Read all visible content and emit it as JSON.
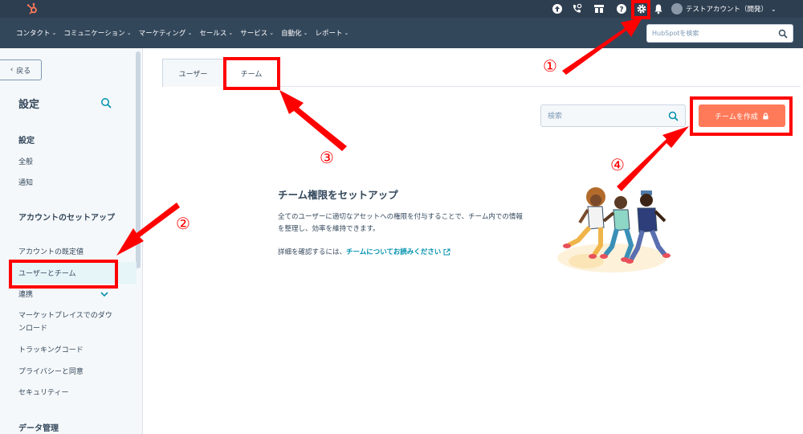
{
  "topbar": {
    "account_name": "テストアカウント（開発）",
    "icons": [
      "upgrade-icon",
      "calling-icon",
      "marketplace-icon",
      "help-icon",
      "settings-icon",
      "notifications-icon"
    ]
  },
  "nav": {
    "items": [
      {
        "label": "コンタクト"
      },
      {
        "label": "コミュニケーション"
      },
      {
        "label": "マーケティング"
      },
      {
        "label": "セールス"
      },
      {
        "label": "サービス"
      },
      {
        "label": "自動化"
      },
      {
        "label": "レポート"
      }
    ],
    "search_placeholder": "HubSpotを検索"
  },
  "sidebar": {
    "back_label": "戻る",
    "title": "設定",
    "sections": [
      {
        "label": "設定"
      },
      {
        "label": "アカウントのセットアップ"
      },
      {
        "label": "データ管理"
      }
    ],
    "items": [
      {
        "label": "全般"
      },
      {
        "label": "通知"
      },
      {
        "label": "アカウントの既定値"
      },
      {
        "label": "ユーザーとチーム"
      },
      {
        "label": "連携"
      },
      {
        "label": "マーケットプレイスでのダウンロード"
      },
      {
        "label": "トラッキングコード"
      },
      {
        "label": "プライバシーと同意"
      },
      {
        "label": "セキュリティー"
      }
    ]
  },
  "main": {
    "tabs": [
      {
        "label": "ユーザー"
      },
      {
        "label": "チーム"
      }
    ],
    "search_placeholder": "検索",
    "create_button": "チームを作成",
    "empty_title": "チーム権限をセットアップ",
    "empty_desc": "全てのユーザーに適切なアセットへの権限を付与することで、チーム内での情報を整理し、効率を維持できます。",
    "empty_link_prefix": "詳細を確認するには、",
    "empty_link": "チームについてお読みください"
  },
  "annotations": {
    "numbers": [
      "①",
      "②",
      "③",
      "④"
    ],
    "color": "#ff0000"
  },
  "colors": {
    "topbar": "#2d3e50",
    "navbar": "#33475b",
    "accent": "#ff7a59",
    "link": "#0091ae",
    "sidebar_active": "#e5f5f8"
  }
}
